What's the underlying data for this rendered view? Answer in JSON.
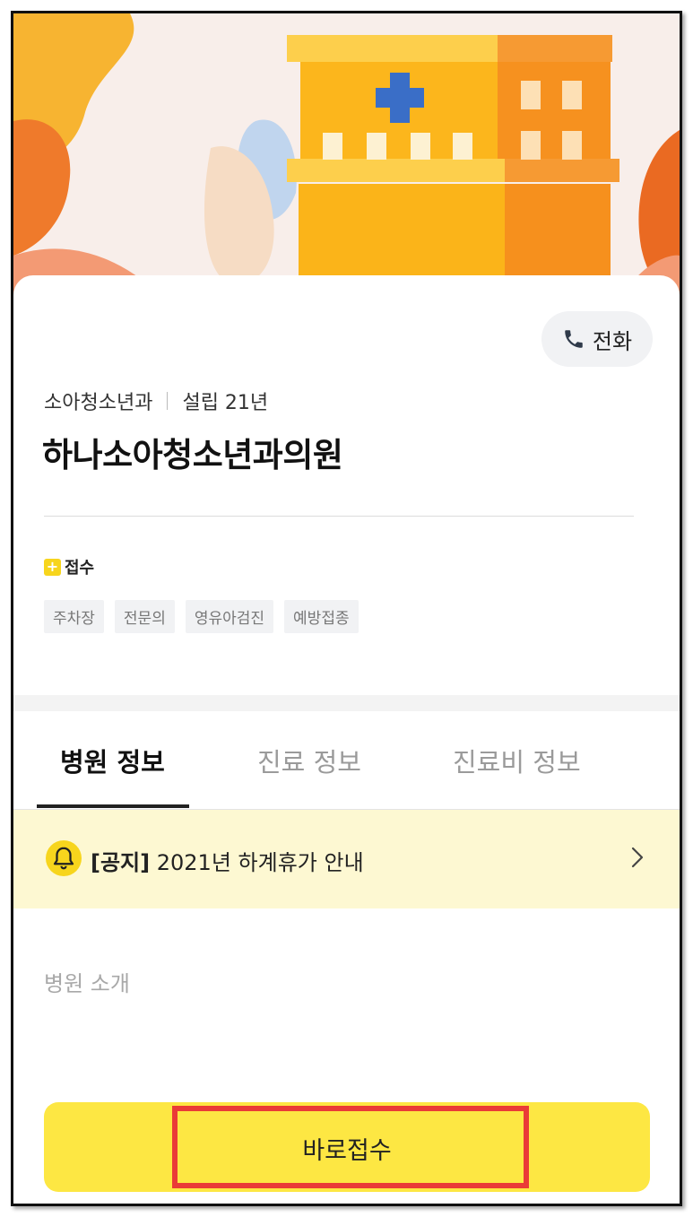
{
  "header": {
    "call_label": "전화",
    "department": "소아청소년과",
    "established": "설립 21년",
    "hospital_name": "하나소아청소년과의원"
  },
  "features": {
    "receipt_label": "접수",
    "tags": [
      "주차장",
      "전문의",
      "영유아검진",
      "예방접종"
    ]
  },
  "tabs": [
    {
      "label": "병원 정보",
      "active": true
    },
    {
      "label": "진료 정보",
      "active": false
    },
    {
      "label": "진료비 정보",
      "active": false
    }
  ],
  "notice": {
    "tag": "[공지]",
    "text": "2021년 하계휴가 안내"
  },
  "intro": {
    "label": "병원 소개"
  },
  "cta": {
    "label": "바로접수"
  },
  "icons": {
    "call": "phone-icon",
    "notice": "bell-icon",
    "arrow": "chevron-right-icon",
    "receipt": "plus-icon"
  },
  "colors": {
    "accent_yellow": "#fde743",
    "notice_bg": "#fdf8d2",
    "highlight_red": "#ea3b37"
  }
}
